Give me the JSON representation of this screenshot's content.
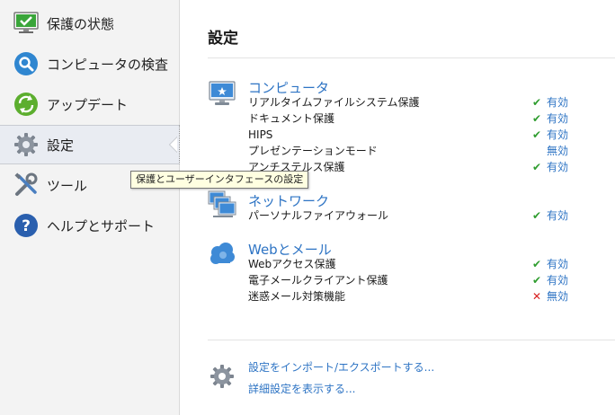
{
  "sidebar": {
    "items": [
      {
        "label": "保護の状態",
        "icon": "monitor-check-icon"
      },
      {
        "label": "コンピュータの検査",
        "icon": "magnifier-icon"
      },
      {
        "label": "アップデート",
        "icon": "update-arrows-icon"
      },
      {
        "label": "設定",
        "icon": "gear-icon",
        "active": true
      },
      {
        "label": "ツール",
        "icon": "tools-icon"
      },
      {
        "label": "ヘルプとサポート",
        "icon": "help-icon"
      }
    ],
    "tooltip": "保護とユーザーインタフェースの設定"
  },
  "main": {
    "title": "設定",
    "sections": [
      {
        "title": "コンピュータ",
        "icon": "computer-icon",
        "rows": [
          {
            "name": "リアルタイムファイルシステム保護",
            "status": "有効",
            "mark": "check"
          },
          {
            "name": "ドキュメント保護",
            "status": "有効",
            "mark": "check"
          },
          {
            "name": "HIPS",
            "status": "有効",
            "mark": "check"
          },
          {
            "name": "プレゼンテーションモード",
            "status": "無効",
            "mark": ""
          },
          {
            "name": "アンチステルス保護",
            "status": "有効",
            "mark": "check"
          }
        ]
      },
      {
        "title": "ネットワーク",
        "icon": "network-icon",
        "rows": [
          {
            "name": "パーソナルファイアウォール",
            "status": "有効",
            "mark": "check"
          }
        ]
      },
      {
        "title": "Webとメール",
        "icon": "web-mail-cloud-icon",
        "rows": [
          {
            "name": "Webアクセス保護",
            "status": "有効",
            "mark": "check"
          },
          {
            "name": "電子メールクライアント保護",
            "status": "有効",
            "mark": "check"
          },
          {
            "name": "迷惑メール対策機能",
            "status": "無効",
            "mark": "cross"
          }
        ]
      }
    ],
    "links": [
      {
        "label": "設定をインポート/エクスポートする..."
      },
      {
        "label": "詳細設定を表示する..."
      }
    ],
    "colors": {
      "link": "#2e74c4",
      "ok": "#2f9d2f",
      "off": "#d82020"
    }
  }
}
